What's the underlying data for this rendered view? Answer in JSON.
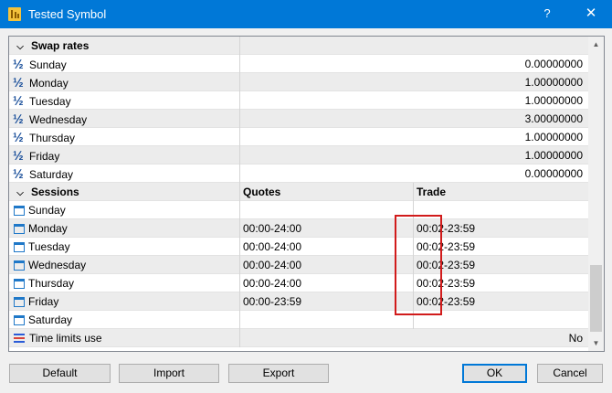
{
  "window": {
    "title": "Tested Symbol",
    "help": "?",
    "close": "✕"
  },
  "swap_section": {
    "label": "Swap rates",
    "rows": [
      {
        "day": "Sunday",
        "value": "0.00000000"
      },
      {
        "day": "Monday",
        "value": "1.00000000"
      },
      {
        "day": "Tuesday",
        "value": "1.00000000"
      },
      {
        "day": "Wednesday",
        "value": "3.00000000"
      },
      {
        "day": "Thursday",
        "value": "1.00000000"
      },
      {
        "day": "Friday",
        "value": "1.00000000"
      },
      {
        "day": "Saturday",
        "value": "0.00000000"
      }
    ]
  },
  "sessions_section": {
    "label": "Sessions",
    "quotes_header": "Quotes",
    "trade_header": "Trade",
    "rows": [
      {
        "day": "Sunday",
        "quotes": "",
        "trade": ""
      },
      {
        "day": "Monday",
        "quotes": "00:00-24:00",
        "trade": "00:02-23:59"
      },
      {
        "day": "Tuesday",
        "quotes": "00:00-24:00",
        "trade": "00:02-23:59"
      },
      {
        "day": "Wednesday",
        "quotes": "00:00-24:00",
        "trade": "00:02-23:59"
      },
      {
        "day": "Thursday",
        "quotes": "00:00-24:00",
        "trade": "00:02-23:59"
      },
      {
        "day": "Friday",
        "quotes": "00:00-23:59",
        "trade": "00:02-23:59"
      },
      {
        "day": "Saturday",
        "quotes": "",
        "trade": ""
      }
    ]
  },
  "time_limits": {
    "label": "Time limits use",
    "value": "No"
  },
  "buttons": {
    "default": "Default",
    "import": "Import",
    "export": "Export",
    "ok": "OK",
    "cancel": "Cancel"
  },
  "colors": {
    "titlebar": "#0078d7",
    "highlight": "#d11b1b",
    "calendar_icon": "#1f78c8"
  }
}
